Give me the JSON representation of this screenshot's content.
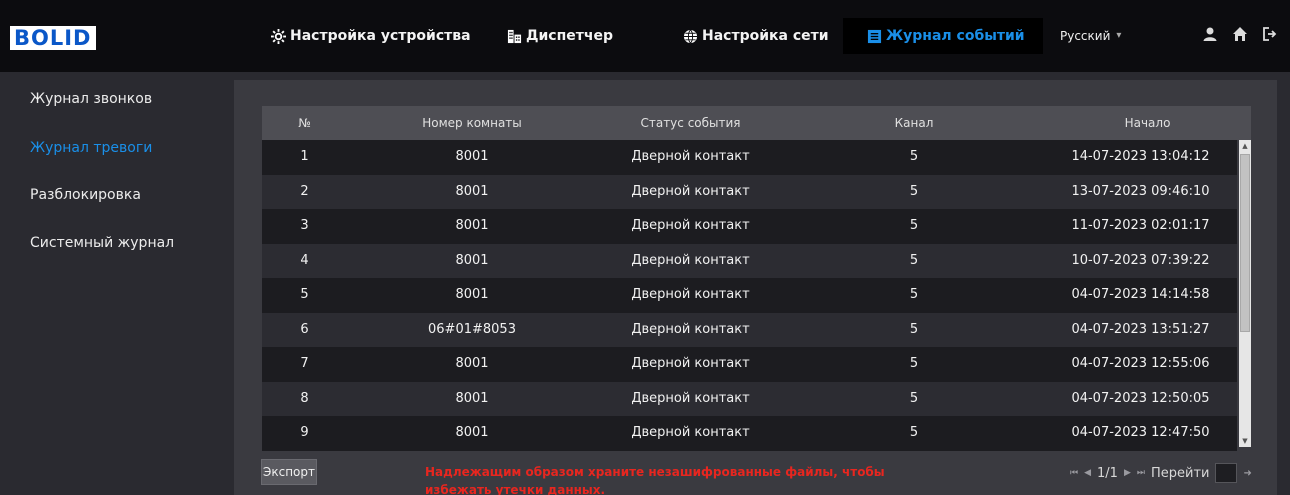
{
  "brand": {
    "logo_text": "BOLID"
  },
  "nav": {
    "device_settings": "Настройка устройства",
    "dispatcher": "Диспетчер",
    "network_settings": "Настройка сети",
    "event_log": "Журнал событий",
    "language": "Русский"
  },
  "sidebar": {
    "items": [
      {
        "label": "Журнал звонков"
      },
      {
        "label": "Журнал тревоги"
      },
      {
        "label": "Разблокировка"
      },
      {
        "label": "Системный журнал"
      }
    ]
  },
  "table": {
    "headers": [
      "№",
      "Номер комнаты",
      "Статус события",
      "Канал",
      "Начало"
    ],
    "rows": [
      [
        "1",
        "8001",
        "Дверной контакт",
        "5",
        "14-07-2023 13:04:12"
      ],
      [
        "2",
        "8001",
        "Дверной контакт",
        "5",
        "13-07-2023 09:46:10"
      ],
      [
        "3",
        "8001",
        "Дверной контакт",
        "5",
        "11-07-2023 02:01:17"
      ],
      [
        "4",
        "8001",
        "Дверной контакт",
        "5",
        "10-07-2023 07:39:22"
      ],
      [
        "5",
        "8001",
        "Дверной контакт",
        "5",
        "04-07-2023 14:14:58"
      ],
      [
        "6",
        "06#01#8053",
        "Дверной контакт",
        "5",
        "04-07-2023 13:51:27"
      ],
      [
        "7",
        "8001",
        "Дверной контакт",
        "5",
        "04-07-2023 12:55:06"
      ],
      [
        "8",
        "8001",
        "Дверной контакт",
        "5",
        "04-07-2023 12:50:05"
      ],
      [
        "9",
        "8001",
        "Дверной контакт",
        "5",
        "04-07-2023 12:47:50"
      ]
    ]
  },
  "footer": {
    "export_label": "Экспорт",
    "warning": "Надлежащим образом храните незашифрованные файлы, чтобы избежать утечки данных.",
    "page_indicator": "1/1",
    "goto_label": "Перейти"
  },
  "colors": {
    "accent": "#1a8fe8",
    "warning": "#e8261f",
    "logo_blue": "#0a57c8"
  }
}
